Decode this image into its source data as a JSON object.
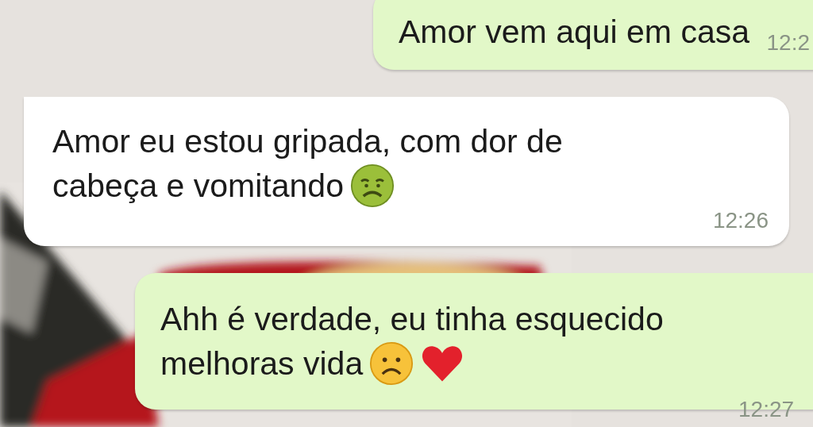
{
  "messages": [
    {
      "kind": "sent",
      "lines": [
        "Amor vem aqui em casa"
      ],
      "time": "12:2"
    },
    {
      "kind": "received",
      "lines": [
        "Amor eu estou gripada, com dor de",
        "cabeça e vomitando"
      ],
      "icons": [
        {
          "kind": "nauseated"
        }
      ],
      "time": "12:26"
    },
    {
      "kind": "sent",
      "lines": [
        "Ahh é verdade, eu tinha esquecido",
        "melhoras vida"
      ],
      "icons": [
        {
          "kind": "frown"
        },
        {
          "kind": "heart"
        }
      ],
      "time": "12:27"
    }
  ]
}
